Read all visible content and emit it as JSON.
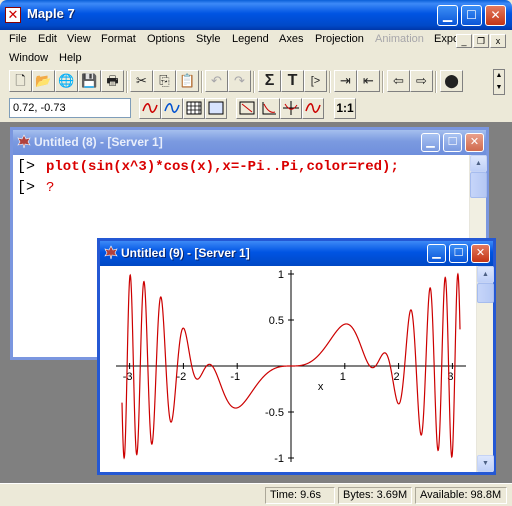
{
  "app": {
    "title": "Maple 7"
  },
  "menu": [
    "File",
    "Edit",
    "View",
    "Format",
    "Options",
    "Style",
    "Legend",
    "Axes",
    "Projection",
    "Animation",
    "Export"
  ],
  "menu_row2": [
    "Window",
    "Help"
  ],
  "disabled_menu": "Animation",
  "toolbar": {
    "icons": [
      "new-icon",
      "open-icon",
      "open-url-icon",
      "save-icon",
      "print-icon",
      "cut-icon",
      "copy-icon",
      "paste-icon",
      "undo-icon",
      "redo-icon",
      "sum-icon",
      "text-icon",
      "prompt-icon",
      "indent-icon",
      "outdent-icon",
      "back-icon",
      "forward-icon",
      "stop-icon"
    ],
    "sigma_glyph": "Σ",
    "t_glyph": "T",
    "prompt_glyph": "[>"
  },
  "context": {
    "coords": "0.72, -0.73",
    "ratio_label": "1:1"
  },
  "worksheet": {
    "title": "Untitled (8) - [Server 1]",
    "bracket": "[>",
    "command": "plot(sin(x^3)*cos(x),x=-Pi..Pi,color=red);",
    "cursor_line": "?"
  },
  "plot_window": {
    "title": "Untitled (9) - [Server 1]"
  },
  "chart_data": {
    "type": "line",
    "function": "sin(x^3)*cos(x)",
    "x_range": [
      -3.14159,
      3.14159
    ],
    "y_range": [
      -1,
      1
    ],
    "series": [
      {
        "color": "#cc0000"
      }
    ],
    "x_ticks": [
      "-3",
      "-2",
      "-1",
      "1",
      "2",
      "3"
    ],
    "x_tick_values": [
      -3,
      -2,
      -1,
      1,
      2,
      3
    ],
    "y_ticks": [
      "1",
      "0.5",
      "-0.5",
      "-1"
    ],
    "y_tick_values": [
      1,
      0.5,
      -0.5,
      -1
    ],
    "xlabel": "x",
    "ylabel": ""
  },
  "status": {
    "time": "Time:   9.6s",
    "bytes": "Bytes: 3.69M",
    "available": "Available: 98.8M"
  },
  "colors": {
    "titlebar": "#0054e3",
    "plot_line": "#cc0000",
    "input_text": "#d90000",
    "workspace": "#808080"
  }
}
